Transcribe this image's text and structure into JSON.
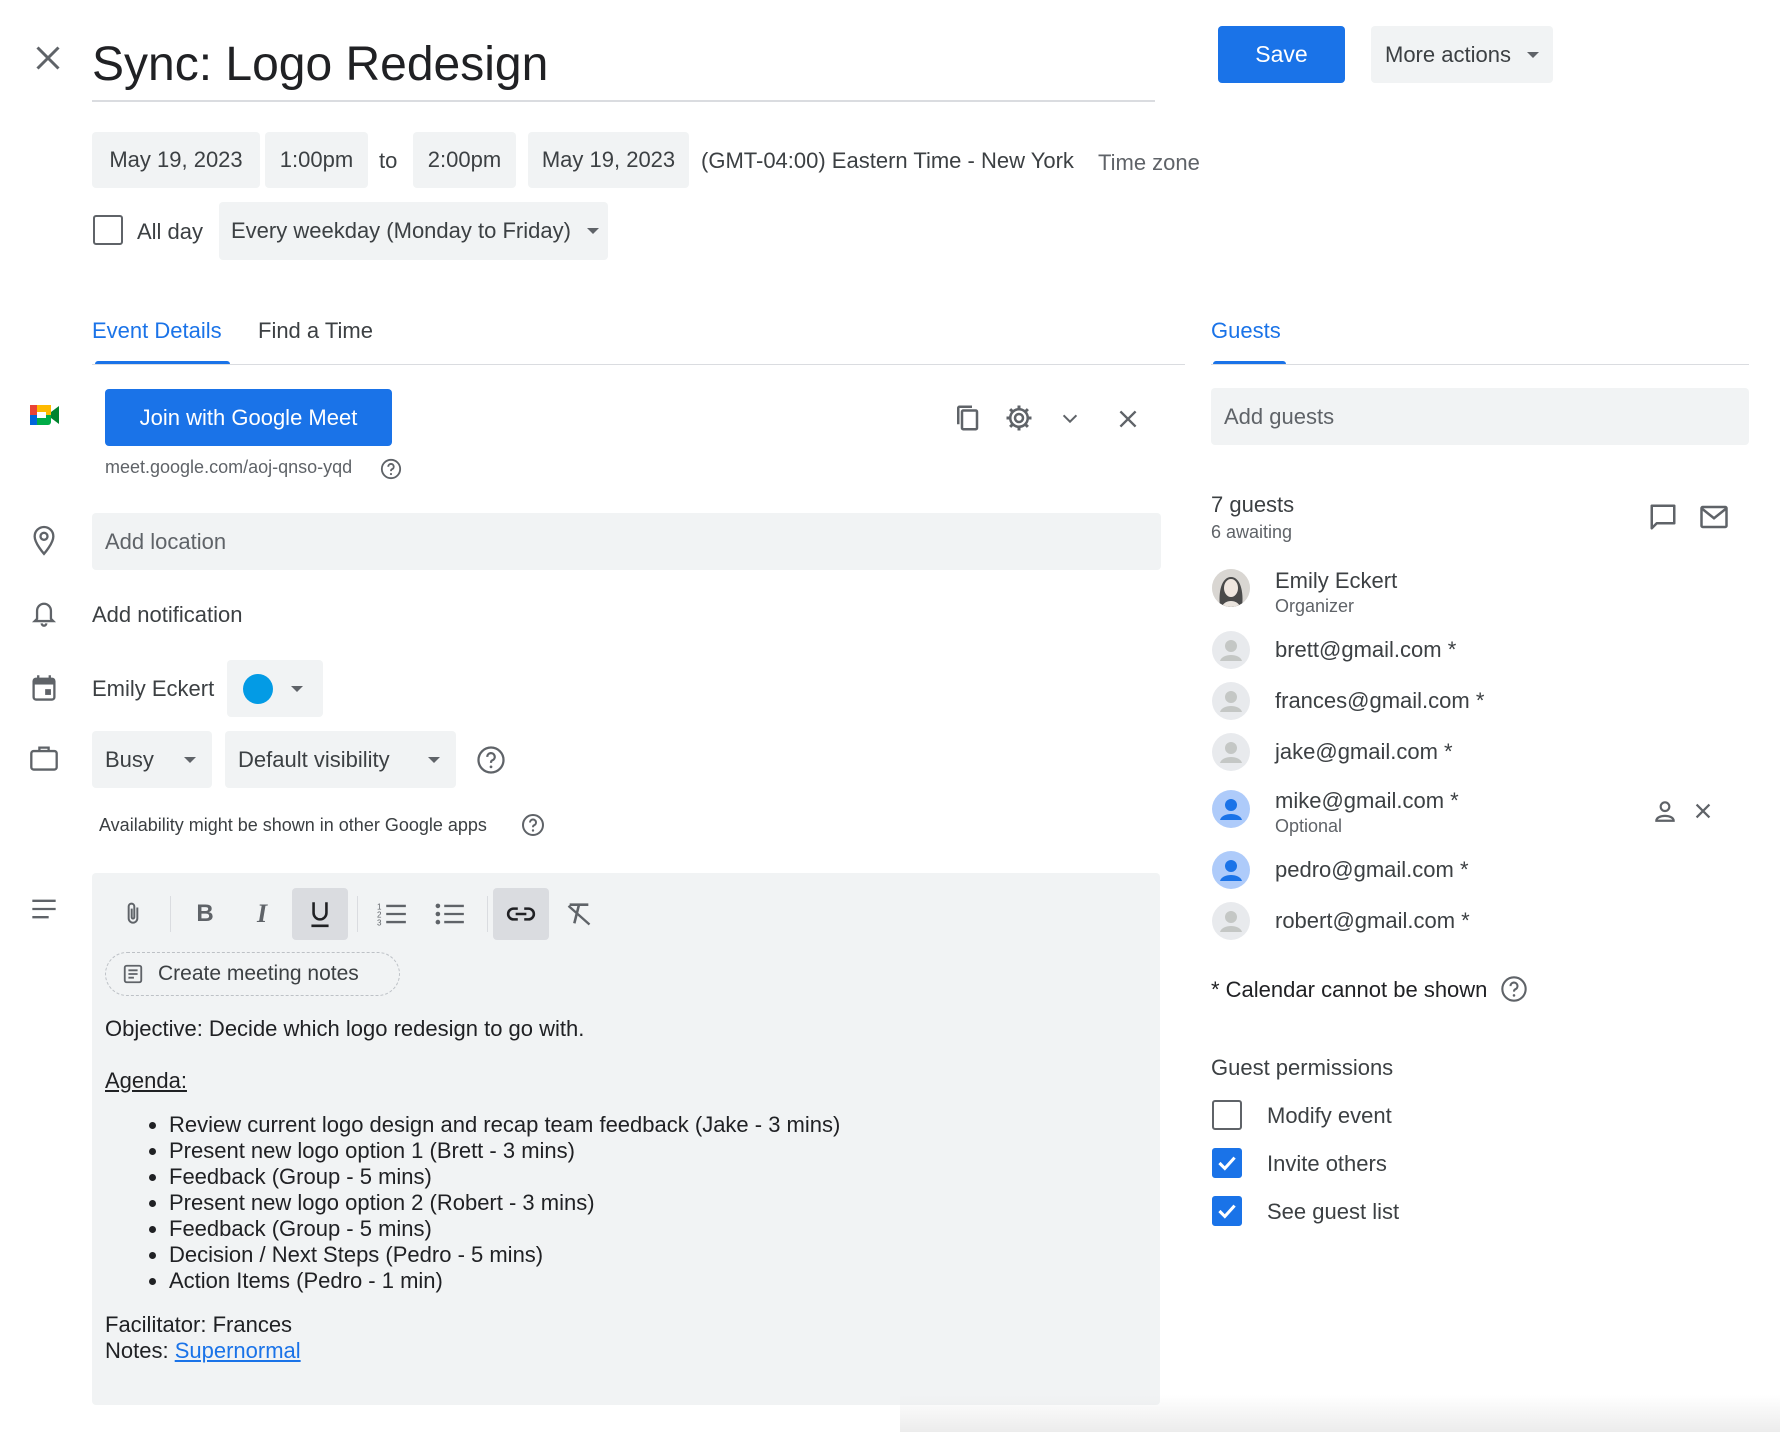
{
  "header": {
    "title": "Sync: Logo Redesign",
    "save_label": "Save",
    "more_actions_label": "More actions"
  },
  "datetime": {
    "start_date": "May 19, 2023",
    "start_time": "1:00pm",
    "to_label": "to",
    "end_time": "2:00pm",
    "end_date": "May 19, 2023",
    "timezone_display": "(GMT-04:00) Eastern Time - New York",
    "timezone_link": "Time zone",
    "all_day_label": "All day",
    "all_day_checked": false,
    "recurrence": "Every weekday (Monday to Friday)"
  },
  "tabs": {
    "event_details": "Event Details",
    "find_a_time": "Find a Time",
    "guests": "Guests"
  },
  "meet": {
    "join_label": "Join with Google Meet",
    "link": "meet.google.com/aoj-qnso-yqd"
  },
  "location": {
    "placeholder": "Add location"
  },
  "notification": {
    "label": "Add notification"
  },
  "calendar": {
    "owner": "Emily Eckert",
    "color": "#039be5"
  },
  "availability": {
    "status": "Busy",
    "visibility": "Default visibility",
    "note": "Availability might be shown in other Google apps"
  },
  "editor": {
    "create_notes_label": "Create meeting notes",
    "objective": "Objective: Decide which logo redesign to go with.",
    "agenda_heading": "Agenda:",
    "agenda_items": [
      "Review current logo design and recap team feedback (Jake - 3 mins)",
      "Present new logo option 1 (Brett - 3 mins)",
      "Feedback (Group - 5 mins)",
      "Present new logo option 2 (Robert - 3 mins)",
      "Feedback (Group - 5 mins)",
      "Decision / Next Steps (Pedro - 5 mins)",
      "Action Items (Pedro - 1 min)"
    ],
    "facilitator": "Facilitator: Frances",
    "notes_prefix": "Notes: ",
    "notes_link": "Supernormal"
  },
  "guests_panel": {
    "add_placeholder": "Add guests",
    "count": "7 guests",
    "awaiting": "6 awaiting",
    "list": [
      {
        "name": "Emily Eckert",
        "sub": "Organizer",
        "avatar": "photo"
      },
      {
        "name": "brett@gmail.com *",
        "sub": "",
        "avatar": "grey"
      },
      {
        "name": "frances@gmail.com *",
        "sub": "",
        "avatar": "grey"
      },
      {
        "name": "jake@gmail.com *",
        "sub": "",
        "avatar": "grey"
      },
      {
        "name": "mike@gmail.com *",
        "sub": "Optional",
        "avatar": "blue"
      },
      {
        "name": "pedro@gmail.com *",
        "sub": "",
        "avatar": "blue"
      },
      {
        "name": "robert@gmail.com *",
        "sub": "",
        "avatar": "grey"
      }
    ],
    "calendar_note": "* Calendar cannot be shown",
    "permissions_heading": "Guest permissions",
    "permissions": [
      {
        "label": "Modify event",
        "checked": false
      },
      {
        "label": "Invite others",
        "checked": true
      },
      {
        "label": "See guest list",
        "checked": true
      }
    ]
  },
  "colors": {
    "accent": "#1a73e8",
    "chip_bg": "#f1f3f4",
    "text": "#3c4043",
    "muted": "#5f6368"
  },
  "icons": [
    "close-icon",
    "meet-logo-icon",
    "copy-icon",
    "settings-icon",
    "chevron-down-icon",
    "location-pin-icon",
    "bell-icon",
    "calendar-icon",
    "briefcase-icon",
    "help-icon",
    "description-icon",
    "attach-icon",
    "bold-icon",
    "italic-icon",
    "underline-icon",
    "numbered-list-icon",
    "bulleted-list-icon",
    "link-icon",
    "clear-format-icon",
    "notes-doc-icon",
    "chat-icon",
    "email-icon",
    "person-icon",
    "remove-icon",
    "check-icon"
  ]
}
